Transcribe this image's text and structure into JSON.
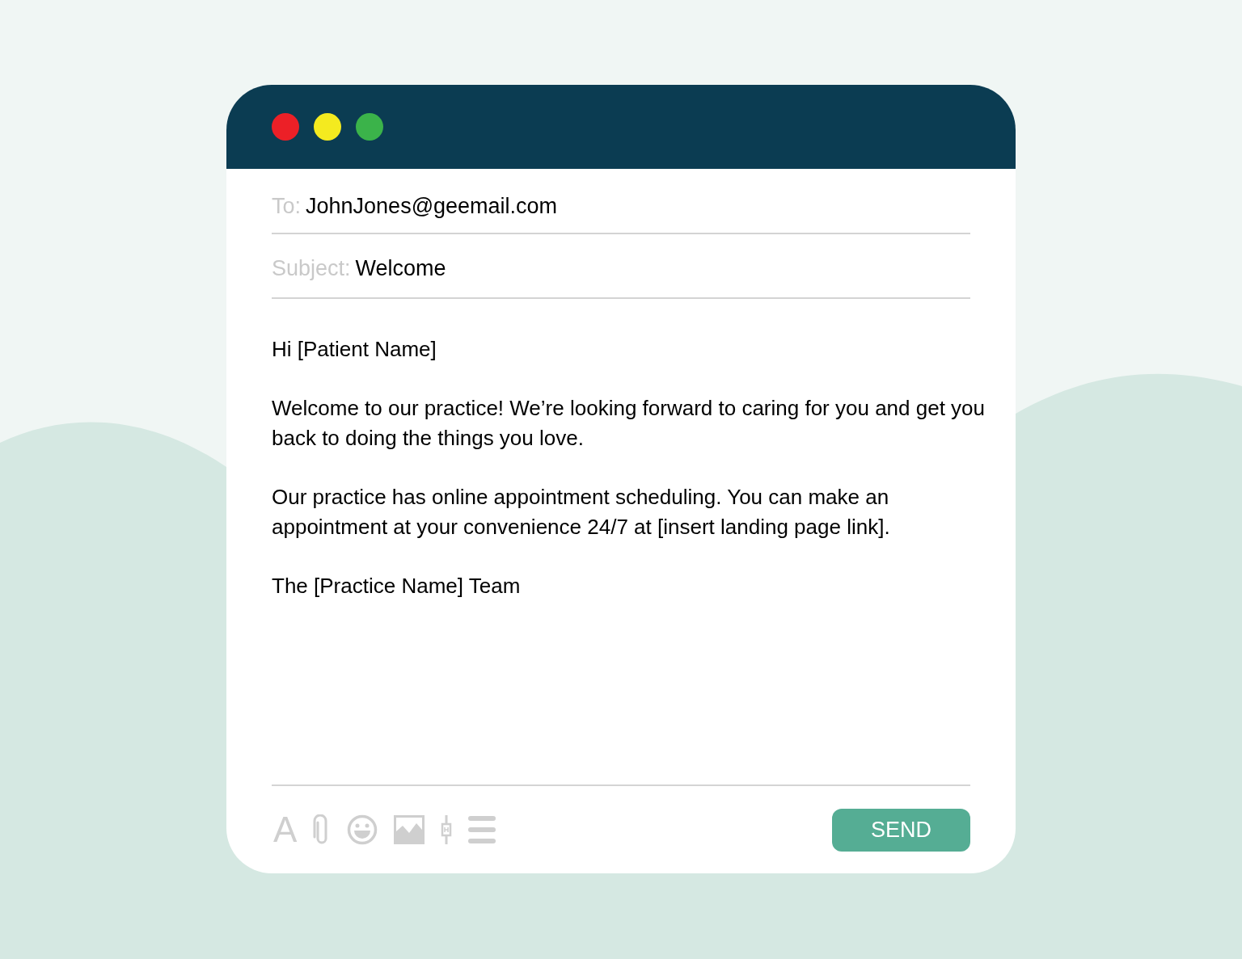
{
  "window": {
    "controls": [
      {
        "color": "#ec2027"
      },
      {
        "color": "#f4ea1f"
      },
      {
        "color": "#3bb34a"
      }
    ]
  },
  "fields": [
    {
      "label": "To:",
      "value": "JohnJones@geemail.com"
    },
    {
      "label": "Subject:",
      "value": "Welcome"
    }
  ],
  "body": [
    "Hi [Patient Name]",
    "Welcome to our practice! We’re looking forward to caring for you and get you back to doing the things you love.",
    "Our practice has online appointment scheduling. You can make an appointment at your convenience 24/7 at [insert landing page link].",
    "The [Practice Name] Team"
  ],
  "toolbar": [
    {
      "kind": "format",
      "label": "A"
    },
    {
      "kind": "attach"
    },
    {
      "kind": "emoji"
    },
    {
      "kind": "image"
    },
    {
      "kind": "signature"
    },
    {
      "kind": "more"
    }
  ],
  "send_button": "SEND"
}
